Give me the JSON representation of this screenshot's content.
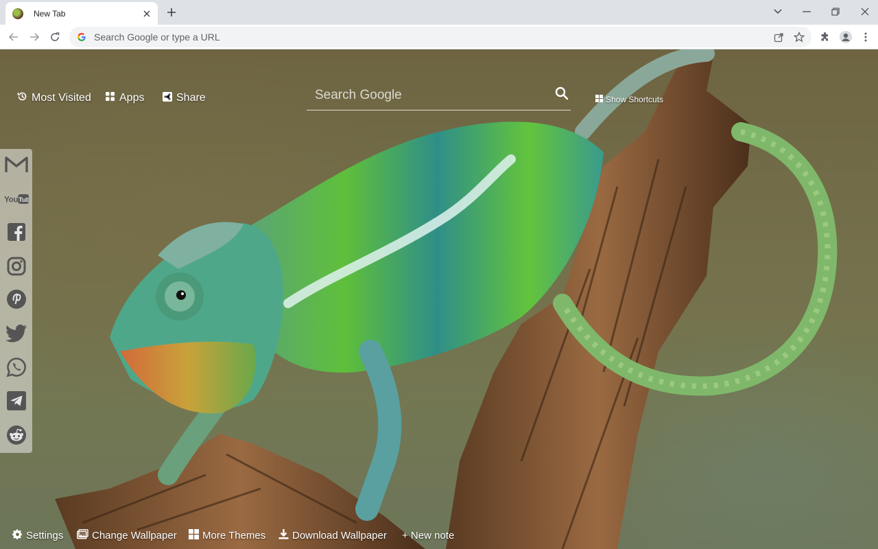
{
  "tab": {
    "title": "New Tab"
  },
  "omnibox": {
    "placeholder": "Search Google or type a URL"
  },
  "newtab": {
    "top_links": [
      {
        "label": "Most Visited",
        "icon": "history-icon"
      },
      {
        "label": "Apps",
        "icon": "apps-grid-icon"
      },
      {
        "label": "Share",
        "icon": "share-icon"
      }
    ],
    "search": {
      "placeholder": "Search Google"
    },
    "show_shortcuts": "Show Shortcuts",
    "social": [
      "gmail-icon",
      "youtube-icon",
      "facebook-icon",
      "instagram-icon",
      "pinterest-icon",
      "twitter-icon",
      "whatsapp-icon",
      "telegram-icon",
      "reddit-icon"
    ],
    "youtube_text": "YouTube",
    "bottom_links": [
      {
        "label": "Settings",
        "icon": "gear-icon"
      },
      {
        "label": "Change Wallpaper",
        "icon": "image-icon"
      },
      {
        "label": "More Themes",
        "icon": "grid-icon"
      },
      {
        "label": "Download Wallpaper",
        "icon": "download-icon"
      },
      {
        "label": "+ New note"
      }
    ]
  },
  "colors": {
    "tabstrip": "#dee1e6",
    "toolbar": "#ffffff",
    "omnibox": "#f1f3f4",
    "sidebar": "#ebebeb"
  }
}
